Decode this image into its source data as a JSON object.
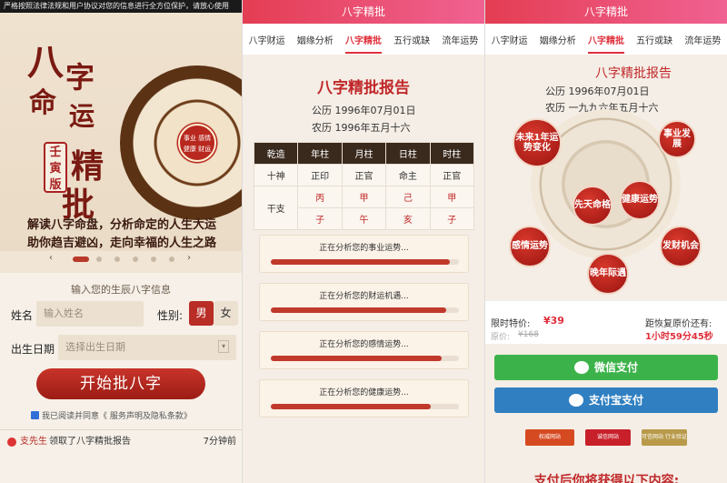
{
  "panel1": {
    "notice": "严格按照法律法规和用户协议对您的信息进行全方位保护，请放心使用",
    "title_chars": [
      "八",
      "字",
      "命",
      "运",
      "精",
      "批"
    ],
    "seal": "壬寅版",
    "wheel_center": "事业 感情 健康 财运",
    "hero_line1": "解读八字命盘，分析命定的人生大运",
    "hero_line2": "助你趋吉避凶，走向幸福的人生之路",
    "form_title": "输入您的生辰八字信息",
    "name_label": "姓名",
    "name_placeholder": "输入姓名",
    "gender_label": "性别:",
    "male": "男",
    "female": "女",
    "birth_label": "出生日期",
    "birth_placeholder": "选择出生日期",
    "start_button": "开始批八字",
    "agree_prefix": "我已阅读并同意",
    "agree_link": "《 服务声明及隐私条款》",
    "feed_user": "支先生",
    "feed_text": "领取了八字精批报告",
    "feed_time": "7分钟前"
  },
  "tabs": [
    "八字财运",
    "姻缘分析",
    "八字精批",
    "五行或缺",
    "流年运势"
  ],
  "panel2": {
    "topbar": "八字精批",
    "report_title": "八字精批报告",
    "solar": "公历 1996年07月01日",
    "lunar": "农历 1996年五月十六",
    "headers": [
      "乾造",
      "年柱",
      "月柱",
      "日柱",
      "时柱"
    ],
    "row_shishen": [
      "十神",
      "正印",
      "正官",
      "命主",
      "正官"
    ],
    "row_gan": [
      "干支",
      "丙",
      "甲",
      "己",
      "甲"
    ],
    "row_zhi": [
      "子",
      "午",
      "亥",
      "子"
    ],
    "progress": [
      {
        "text": "正在分析您的事业运势...",
        "value": 0.95
      },
      {
        "text": "正在分析您的财运机遇...",
        "value": 0.93
      },
      {
        "text": "正在分析您的感情运势...",
        "value": 0.91
      },
      {
        "text": "正在分析您的健康运势...",
        "value": 0.85
      }
    ]
  },
  "panel3": {
    "topbar": "八字精批",
    "report_title": "八字精批报告",
    "solar": "公历 1996年07月01日",
    "lunar": "农历 一九九六年五月十六",
    "circles": [
      "未来1年运势变化",
      "事业发展",
      "先天命格",
      "健康运势",
      "感情运势",
      "发财机会",
      "晚年际遇"
    ],
    "limit_label": "限时特价:",
    "price": "¥39",
    "orig_label": "原价:",
    "orig_price": "¥168",
    "countdown_label": "距恢复原价还有:",
    "countdown": "1小时59分45秒",
    "wechat_pay": "微信支付",
    "alipay": "支付宝支付",
    "badges": [
      "权威网站",
      "诚信网站",
      "可信网站 行业验证"
    ],
    "bottom_text": "支付后你将获得以下内容:"
  }
}
